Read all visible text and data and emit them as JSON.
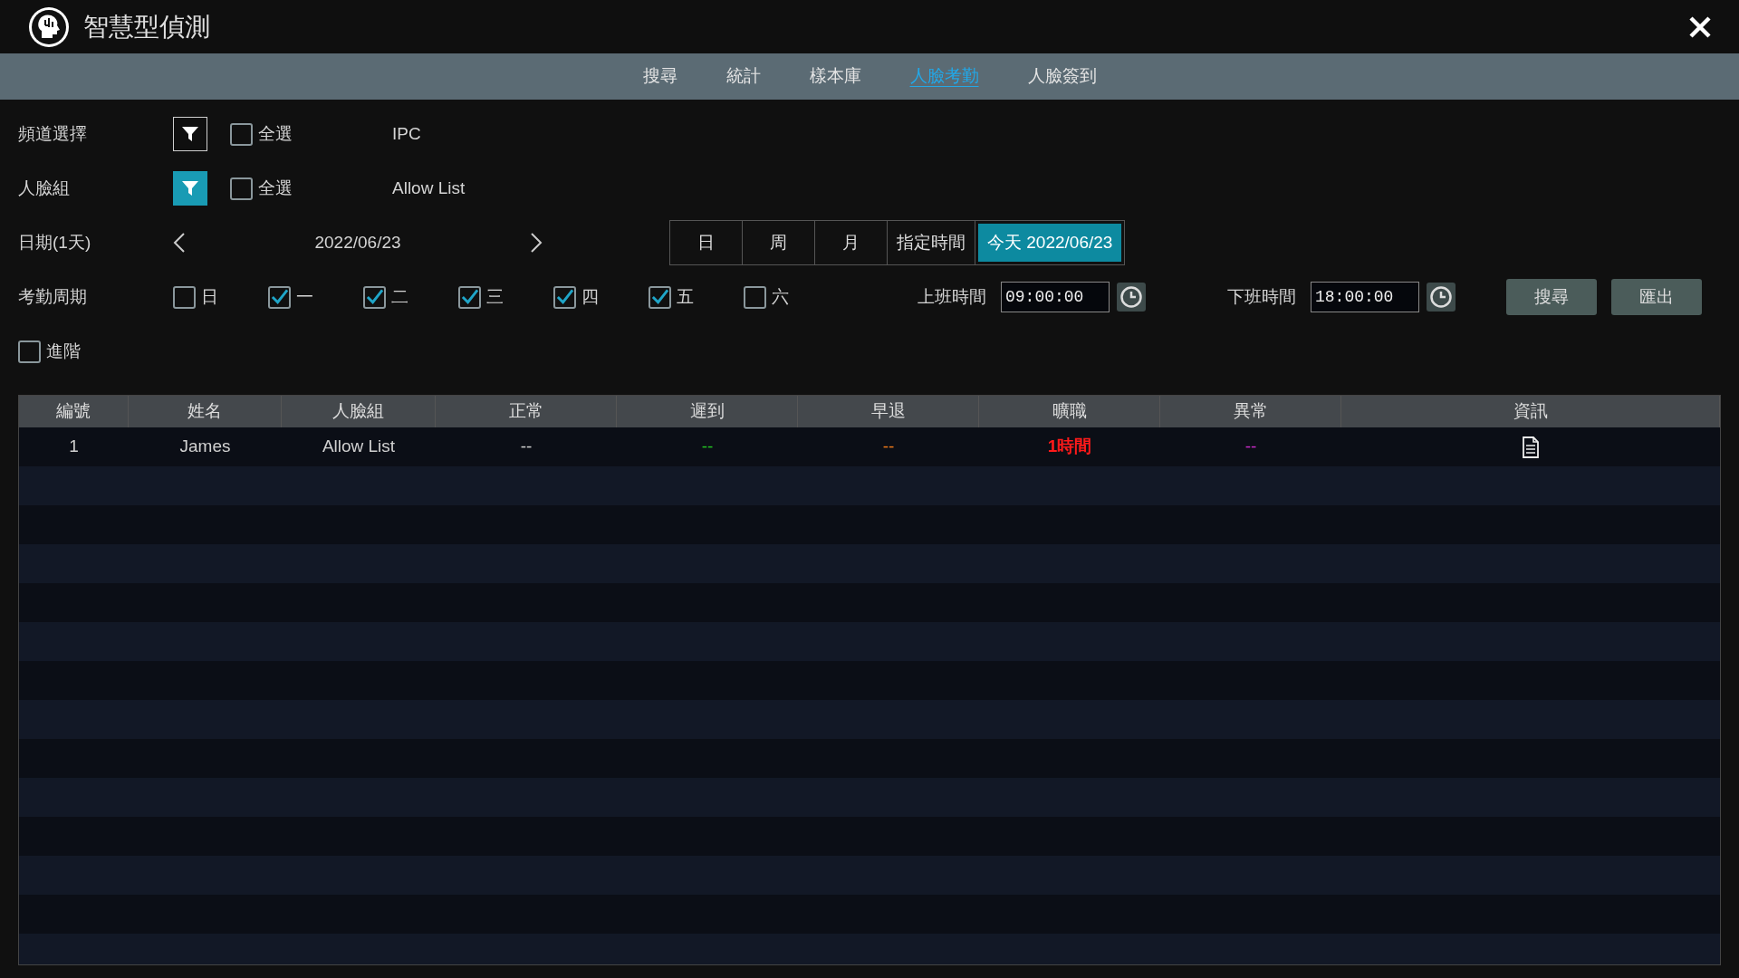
{
  "window": {
    "title": "智慧型偵測"
  },
  "tabs": [
    {
      "label": "搜尋",
      "selected": false
    },
    {
      "label": "統計",
      "selected": false
    },
    {
      "label": "樣本庫",
      "selected": false
    },
    {
      "label": "人臉考勤",
      "selected": true
    },
    {
      "label": "人臉簽到",
      "selected": false
    }
  ],
  "filters": [
    {
      "label": "頻道選擇",
      "active": false,
      "select_all": {
        "label": "全選",
        "checked": false
      },
      "value": "IPC"
    },
    {
      "label": "人臉組",
      "active": true,
      "select_all": {
        "label": "全選",
        "checked": false
      },
      "value": "Allow List"
    }
  ],
  "date": {
    "label": "日期(1天)",
    "value": "2022/06/23",
    "ranges": [
      {
        "label": "日",
        "selected": false
      },
      {
        "label": "周",
        "selected": false
      },
      {
        "label": "月",
        "selected": false
      },
      {
        "label": "指定時間",
        "selected": false
      },
      {
        "label": "今天 2022/06/23",
        "selected": true
      }
    ]
  },
  "attendance_cycle": {
    "label": "考勤周期",
    "days": [
      {
        "label": "日",
        "checked": false
      },
      {
        "label": "一",
        "checked": true
      },
      {
        "label": "二",
        "checked": true
      },
      {
        "label": "三",
        "checked": true
      },
      {
        "label": "四",
        "checked": true
      },
      {
        "label": "五",
        "checked": true
      },
      {
        "label": "六",
        "checked": false
      }
    ]
  },
  "work_start": {
    "label": "上班時間",
    "value": "09:00:00"
  },
  "work_end": {
    "label": "下班時間",
    "value": "18:00:00"
  },
  "buttons": [
    "搜尋",
    "匯出"
  ],
  "advanced": {
    "label": "進階",
    "checked": false
  },
  "table": {
    "columns": [
      "編號",
      "姓名",
      "人臉組",
      "正常",
      "遲到",
      "早退",
      "曠職",
      "異常",
      "資訊"
    ],
    "rows": [
      {
        "cells": [
          {
            "text": "1",
            "color": "#d0d0d0"
          },
          {
            "text": "James",
            "color": "#d0d0d0"
          },
          {
            "text": "Allow List",
            "color": "#d0d0d0"
          },
          {
            "text": "--",
            "color": "#d0d0d0"
          },
          {
            "text": "--",
            "color": "#22c322"
          },
          {
            "text": "--",
            "color": "#f07a18"
          },
          {
            "text": "1時間",
            "color": "#ff1a1a"
          },
          {
            "text": "--",
            "color": "#c92bc9"
          }
        ]
      }
    ]
  }
}
